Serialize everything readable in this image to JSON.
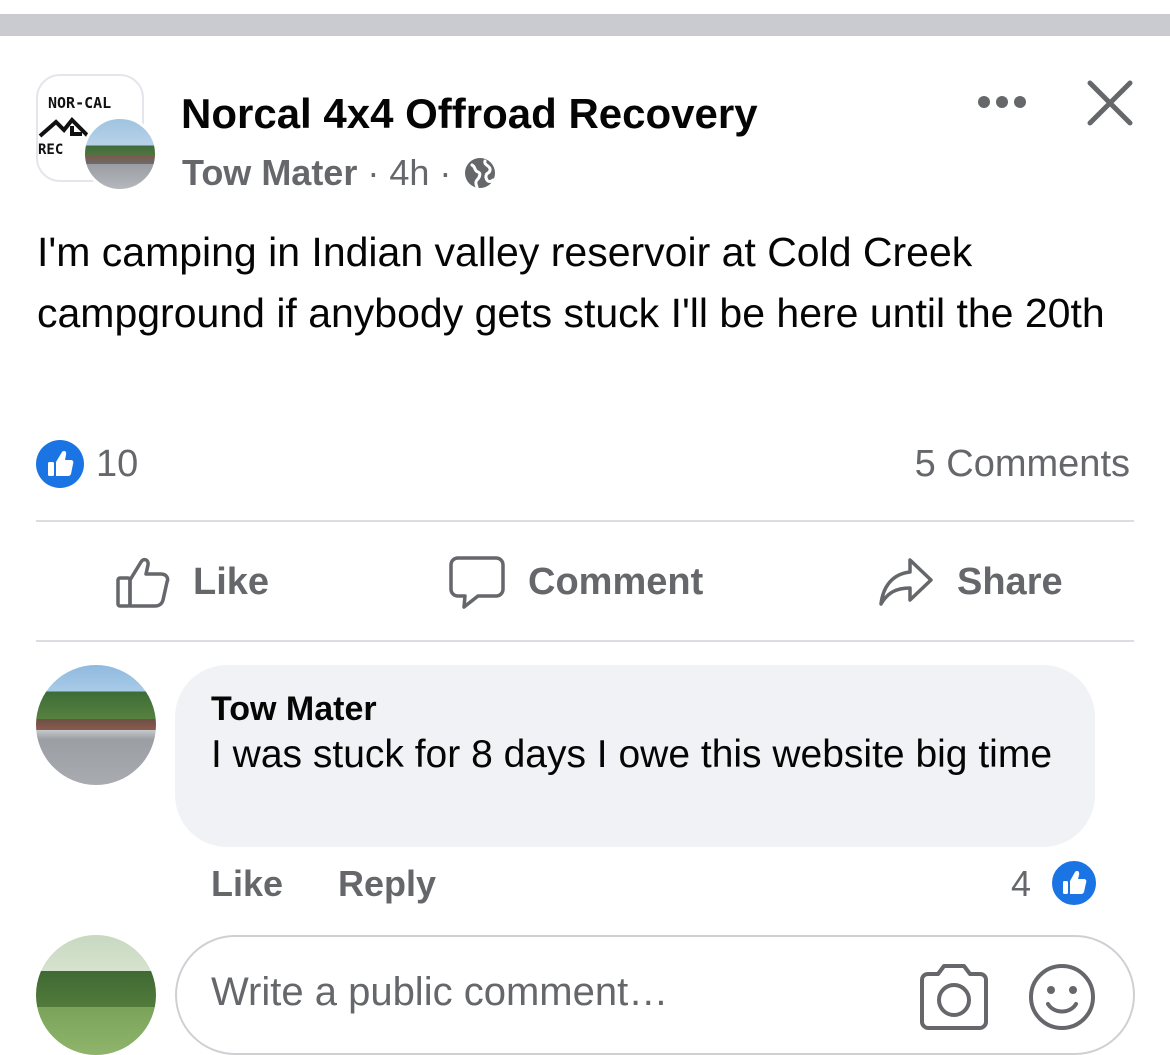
{
  "post": {
    "group_name": "Norcal 4x4 Offroad Recovery",
    "group_logo_line1": "NOR-CAL",
    "group_logo_line2": "REC",
    "author": "Tow Mater",
    "separator": "·",
    "time": "4h",
    "visibility_icon": "globe-icon",
    "text": "I'm camping in Indian valley reservoir at Cold Creek campground if anybody gets stuck I'll be here until the 20th",
    "like_count": "10",
    "comments_count": "5 Comments"
  },
  "actions": {
    "like_label": "Like",
    "comment_label": "Comment",
    "share_label": "Share"
  },
  "comment": {
    "author": "Tow Mater",
    "text": "I was stuck for 8 days I owe this website big time",
    "like_label": "Like",
    "reply_label": "Reply",
    "reaction_count": "4"
  },
  "composer": {
    "placeholder": "Write a public comment…"
  },
  "colors": {
    "brand_blue": "#1b74e4",
    "secondary_text": "#65676b",
    "bubble": "#f0f2f5"
  }
}
